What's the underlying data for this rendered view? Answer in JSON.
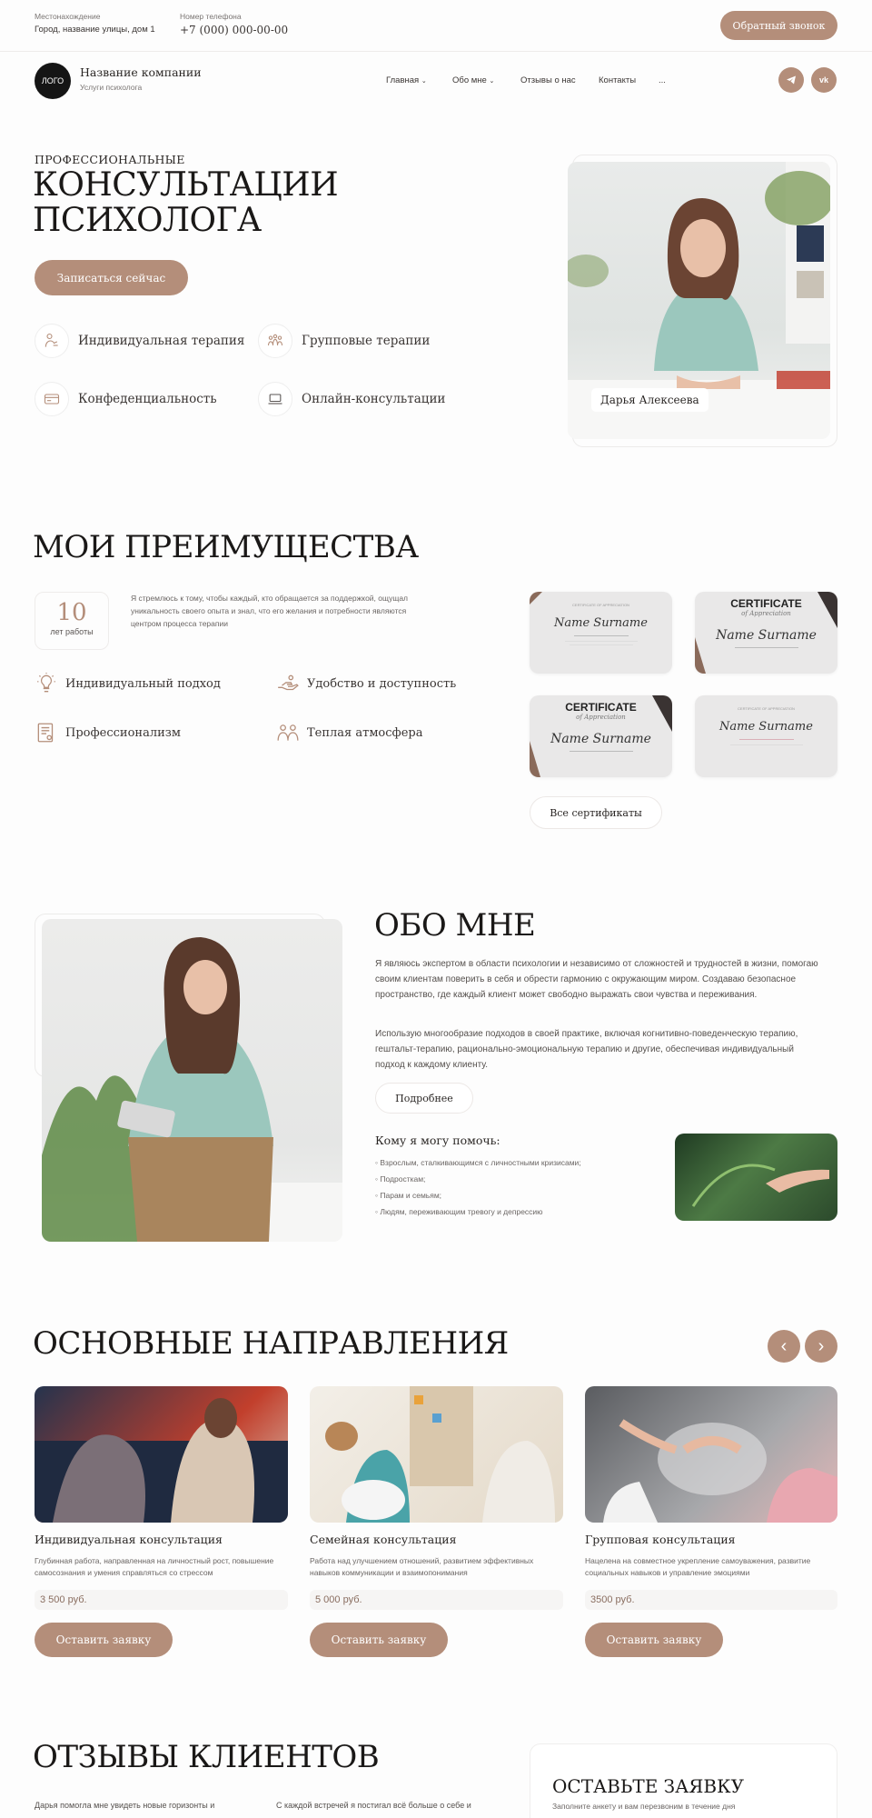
{
  "topbar": {
    "location_label": "Местонахождение",
    "location_value": "Город, название улицы, дом 1",
    "phone_label": "Номер телефона",
    "phone_value": "+7 (000) 000-00-00",
    "callback_button": "Обратный звонок"
  },
  "header": {
    "logo_text": "ЛОГО",
    "company_name": "Название компании",
    "company_sub": "Услуги психолога",
    "nav": [
      {
        "label": "Главная"
      },
      {
        "label": "Обо мне"
      },
      {
        "label": "Отзывы о нас"
      },
      {
        "label": "Контакты"
      },
      {
        "label": "..."
      }
    ],
    "social": [
      "telegram-icon",
      "vk-icon"
    ],
    "vk_text": "vk"
  },
  "hero": {
    "kicker": "ПРОФЕССИОНАЛЬНЫЕ",
    "title_line1": "КОНСУЛЬТАЦИИ",
    "title_line2": "ПСИХОЛОГА",
    "cta": "Записаться сейчас",
    "features": [
      {
        "label": "Индивидуальная терапия",
        "icon": "person-therapy-icon"
      },
      {
        "label": "Групповые терапии",
        "icon": "group-icon"
      },
      {
        "label": "Конфеденциальность",
        "icon": "card-icon"
      },
      {
        "label": "Онлайн-консультации",
        "icon": "laptop-icon"
      }
    ],
    "photo_caption": "Дарья Алексеева"
  },
  "advantages": {
    "title": "МОИ ПРЕИМУЩЕСТВА",
    "years_number": "10",
    "years_label": "лет работы",
    "text": "Я стремлюсь к тому, чтобы каждый, кто обращается за поддержкой, ощущал уникальность своего опыта и знал, что его желания и потребности являются центром процесса терапии",
    "items": [
      {
        "label": "Индивидуальный подход",
        "icon": "lightbulb-icon"
      },
      {
        "label": "Удобство и доступность",
        "icon": "hand-icon"
      },
      {
        "label": "Профессионализм",
        "icon": "certificate-icon"
      },
      {
        "label": "Теплая атмосфера",
        "icon": "people-icon"
      }
    ],
    "certificates": [
      {
        "heading": "",
        "script": "Name Surname"
      },
      {
        "heading": "CERTIFICATE",
        "script": "Name Surname"
      },
      {
        "heading": "CERTIFICATE",
        "script": "Name Surname"
      },
      {
        "heading": "",
        "script": "Name Surname"
      }
    ],
    "certificate_sub": "of Appreciation",
    "all_button": "Все сертификаты"
  },
  "about": {
    "title": "ОБО МНЕ",
    "p1": "Я являюсь экспертом в области психологии и независимо от сложностей и трудностей в жизни, помогаю своим клиентам поверить в себя и обрести гармонию с окружающим миром. Создаваю безопасное пространство, где каждый клиент может свободно выражать свои чувства и переживания.",
    "p2": "Использую многообразие подходов в своей практике, включая когнитивно-поведенческую терапию, гештальт-терапию, рационально-эмоциональную терапию и другие, обеспечивая индивидуальный подход к каждому клиенту.",
    "more_button": "Подробнее",
    "help_title": "Кому я могу помочь:",
    "help_items": [
      {
        "label": "Взрослым, сталкивающимся с личностными кризисами;"
      },
      {
        "label": "Подросткам;"
      },
      {
        "label": "Парам и семьям;"
      },
      {
        "label": "Людям, переживающим тревогу и депрессию"
      }
    ]
  },
  "directions": {
    "title": "ОСНОВНЫЕ НАПРАВЛЕНИЯ",
    "prev": "‹",
    "next": "›",
    "cards": [
      {
        "title": "Индивидуальная консультация",
        "text": "Глубинная работа, направленная на личностный рост, повышение самосознания и умения справляться со стрессом",
        "price": "3 500 руб.",
        "button": "Оставить заявку"
      },
      {
        "title": "Семейная консультация",
        "text": "Работа над улучшением отношений, развитием эффективных навыков коммуникации и взаимопонимания",
        "price": "5 000 руб.",
        "button": "Оставить заявку"
      },
      {
        "title": "Групповая консультация",
        "text": "Нацелена на совместное укрепление самоуважения, развитие социальных навыков и управление эмоциями",
        "price": "3500 руб.",
        "button": "Оставить заявку"
      }
    ]
  },
  "reviews": {
    "title": "ОТЗЫВЫ КЛИЕНТОВ",
    "snippet1": "Дарья помогла мне увидеть новые горизонты и",
    "snippet2": "С каждой встречей я постигал всё больше о себе и",
    "form_title": "ОСТАВЬТЕ ЗАЯВКУ",
    "form_sub": "Заполните анкету и вам перезвоним в течение дня"
  },
  "colors": {
    "accent": "#b48e7a",
    "text": "#1e1c1b",
    "muted": "#7a7573"
  }
}
